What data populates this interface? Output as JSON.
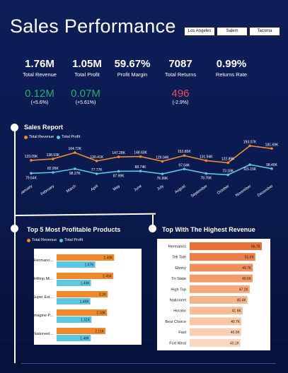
{
  "header": {
    "title": "Sales Performance",
    "cities": [
      "Los Angeles",
      "Salem",
      "Tacoma"
    ]
  },
  "kpis": [
    {
      "value": "1.76M",
      "label": "Total Revenue"
    },
    {
      "value": "1.05M",
      "label": "Total Profit"
    },
    {
      "value": "59.67%",
      "label": "Profit Margin"
    },
    {
      "value": "7087",
      "label": "Total Returns"
    },
    {
      "value": "0.99%",
      "label": "Returns Rate"
    }
  ],
  "deltas": [
    {
      "value": "0.12M",
      "pct": "(+5.6%)",
      "tone": "green"
    },
    {
      "value": "0.07M",
      "pct": "(+5.61%)",
      "tone": "green"
    },
    {
      "value": "496",
      "pct": "(-2.9%)",
      "tone": "red"
    }
  ],
  "colors": {
    "revenue": "#f0892b",
    "profit": "#5bc7e0",
    "bg": "#0e1e58"
  },
  "sales_report": {
    "title": "Sales Report",
    "legend": [
      "Total Revenue",
      "Total Profit"
    ]
  },
  "top_products": {
    "title": "Top 5 Most Profitable Products",
    "legend": [
      "Total Revenue",
      "Total Profit"
    ]
  },
  "top_revenue": {
    "title": "Top With The Highest Revenue"
  },
  "chart_data": [
    {
      "type": "line",
      "title": "Sales Report",
      "categories": [
        "January",
        "February",
        "March",
        "April",
        "May",
        "June",
        "July",
        "August",
        "September",
        "October",
        "November",
        "December"
      ],
      "series": [
        {
          "name": "Total Revenue",
          "values": [
            133.09,
            138.93,
            164.72,
            130.41,
            147.28,
            148.63,
            129.04,
            152.85,
            131.94,
            122.89,
            193.07,
            181.69
          ],
          "labels": [
            "133.09K",
            "138.93K",
            "164.72K",
            "130.41K",
            "147.28K",
            "148.63K",
            "129.04K",
            "152.85K",
            "131.94K",
            "122.89K",
            "193.07K",
            "181.69K"
          ]
        },
        {
          "name": "Total Profit",
          "values": [
            79.54,
            82.95,
            98.27,
            77.77,
            87.99,
            88.74,
            76.99,
            97.04,
            78.76,
            73.18,
            115.15,
            98.49
          ],
          "labels": [
            "79.54K",
            "82.95K",
            "98.27K",
            "77.77K",
            "87.99K",
            "88.74K",
            "76.99K",
            "97.04K",
            "78.76K",
            "73.18K",
            "115.15K",
            "98.49K"
          ]
        }
      ]
    },
    {
      "type": "bar",
      "title": "Top 5 Most Profitable Products",
      "categories": [
        "Hermano...",
        "Hilltop Mi...",
        "Super Est...",
        "Imagine P...",
        "Nationeel..."
      ],
      "series": [
        {
          "name": "Total Revenue",
          "values": [
            2.49,
            2.45,
            2.21,
            2.18,
            2.11
          ],
          "labels": [
            "2.49K",
            "2.45K",
            "2.2K",
            "2.18K",
            "2.11K"
          ]
        },
        {
          "name": "Total Profit",
          "values": [
            1.67,
            1.49,
            1.46,
            1.51,
            1.48
          ],
          "labels": [
            "1.67K",
            "1.49K",
            "1.46K",
            "1.51K",
            "1.48K"
          ]
        }
      ]
    },
    {
      "type": "bar",
      "title": "Top With The Highest Revenue",
      "categories": [
        "Hermanos",
        "Tell Tale",
        "Ebony",
        "Tri-State",
        "High Top",
        "Nationeel",
        "Horatio",
        "Best Choice",
        "Fast",
        "Fort West"
      ],
      "values": [
        56.7,
        51.6,
        49.7,
        49.5,
        47.2,
        45.4,
        41.6,
        40.7,
        40.5,
        40.1
      ],
      "labels": [
        "56.7K",
        "51.6K",
        "49.7K",
        "49.5K",
        "47.2K",
        "45.4K",
        "41.6K",
        "40.7K",
        "40.5K",
        "40.1K"
      ]
    }
  ]
}
